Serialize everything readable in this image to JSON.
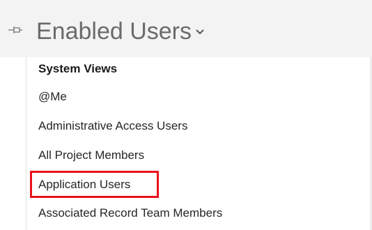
{
  "view_selector": {
    "title": "Enabled Users",
    "pin_icon": "pin-icon",
    "chevron_icon": "chevron-down-icon"
  },
  "menu": {
    "heading": "System Views",
    "items": [
      {
        "label": "@Me"
      },
      {
        "label": "Administrative Access Users"
      },
      {
        "label": "All Project Members"
      },
      {
        "label": "Application Users",
        "highlighted": true
      },
      {
        "label": "Associated Record Team Members"
      }
    ],
    "highlight_color": "#e8141c"
  }
}
